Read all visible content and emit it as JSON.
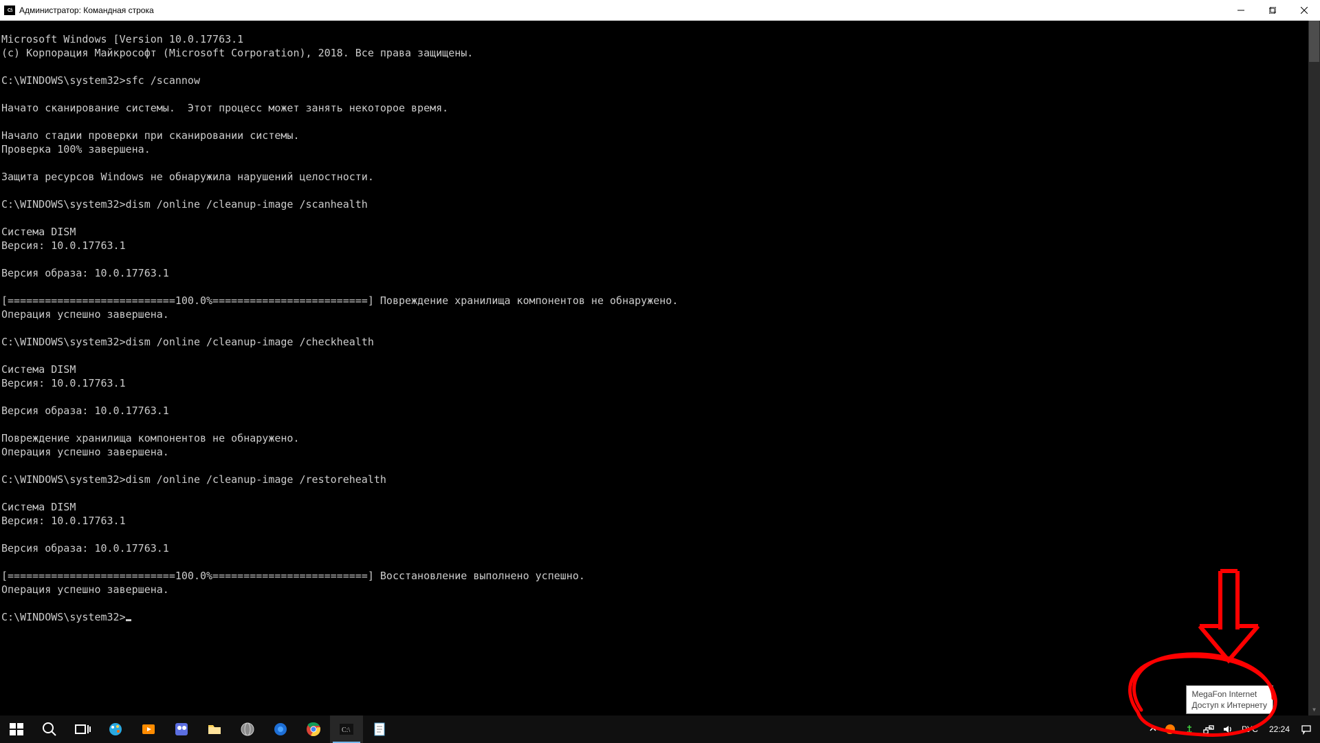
{
  "window": {
    "title": "Администратор: Командная строка",
    "icon_label": "C:\\"
  },
  "console": {
    "lines": [
      "Microsoft Windows [Version 10.0.17763.1",
      "(c) Корпорация Майкрософт (Microsoft Corporation), 2018. Все права защищены.",
      "",
      "C:\\WINDOWS\\system32>sfc /scannow",
      "",
      "Начато сканирование системы.  Этот процесс может занять некоторое время.",
      "",
      "Начало стадии проверки при сканировании системы.",
      "Проверка 100% завершена.",
      "",
      "Защита ресурсов Windows не обнаружила нарушений целостности.",
      "",
      "C:\\WINDOWS\\system32>dism /online /cleanup-image /scanhealth",
      "",
      "Cистема DISM",
      "Версия: 10.0.17763.1",
      "",
      "Версия образа: 10.0.17763.1",
      "",
      "[===========================100.0%=========================] Повреждение хранилища компонентов не обнаружено.",
      "Операция успешно завершена.",
      "",
      "C:\\WINDOWS\\system32>dism /online /cleanup-image /checkhealth",
      "",
      "Cистема DISM",
      "Версия: 10.0.17763.1",
      "",
      "Версия образа: 10.0.17763.1",
      "",
      "Повреждение хранилища компонентов не обнаружено.",
      "Операция успешно завершена.",
      "",
      "C:\\WINDOWS\\system32>dism /online /cleanup-image /restorehealth",
      "",
      "Cистема DISM",
      "Версия: 10.0.17763.1",
      "",
      "Версия образа: 10.0.17763.1",
      "",
      "[===========================100.0%=========================] Восстановление выполнено успешно.",
      "Операция успешно завершена.",
      "",
      "C:\\WINDOWS\\system32>"
    ]
  },
  "tooltip": {
    "line1": "MegaFon Internet",
    "line2": "Доступ к Интернету"
  },
  "taskbar": {
    "lang": "РУС",
    "clock": "22:24"
  }
}
